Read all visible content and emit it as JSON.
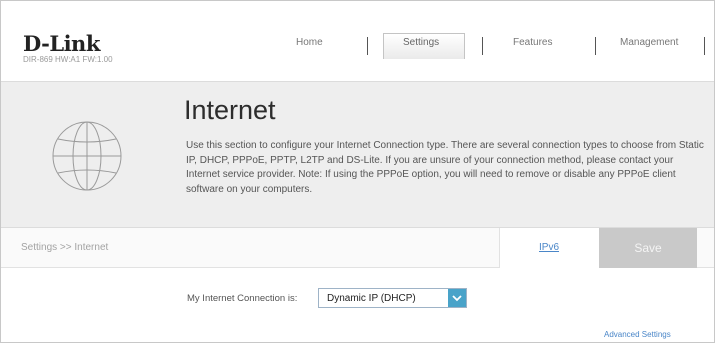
{
  "brand": {
    "logo": "D-Link",
    "model_line": "DIR-869 HW:A1 FW:1.00"
  },
  "nav": {
    "items": [
      "Home",
      "Settings",
      "Features",
      "Management"
    ],
    "active": "Settings"
  },
  "banner": {
    "title": "Internet",
    "description": "Use this section to configure your Internet Connection type. There are several connection types to choose from Static IP, DHCP, PPPoE, PPTP, L2TP and DS-Lite. If you are unsure of your connection method, please contact your Internet service provider. Note: If using the PPPoE option, you will need to remove or disable any PPPoE client software on your computers.",
    "icon": "globe-icon"
  },
  "crumb_bar": {
    "breadcrumb": "Settings >> Internet",
    "ipv6_link": "IPv6",
    "save_label": "Save"
  },
  "form": {
    "connection_label": "My Internet Connection is:",
    "connection_value": "Dynamic IP (DHCP)",
    "advanced_link": "Advanced Settings"
  },
  "colors": {
    "accent": "#49a3c9",
    "link": "#4a86c8",
    "save_disabled": "#c9c9c9",
    "banner_bg": "#eeeeee"
  }
}
